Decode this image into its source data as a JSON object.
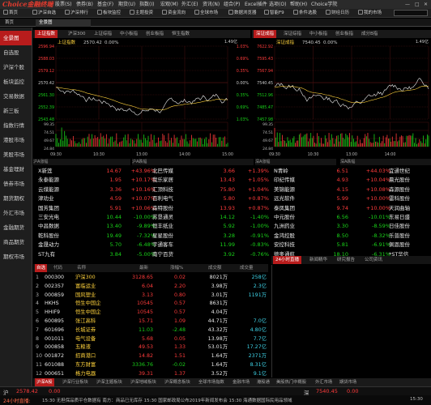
{
  "app": {
    "logo_text": "Choice金融终端",
    "menu": [
      "股票(S)",
      "债券(B)",
      "基金(F)",
      "期货(U)",
      "指数(I)",
      "宏观(M)",
      "外汇(E)",
      "资讯(N)",
      "组合(P)",
      "Excel插件",
      "选项(O)",
      "帮助(H)",
      "Choice学院"
    ],
    "toolbar": [
      "首页",
      "沪深自选",
      "沪深排行",
      "板块监控",
      "主题投资",
      "资金流向",
      "全球市场",
      "数据浏览器",
      "智能F9",
      "条件选股",
      "财经日历",
      "我的市场"
    ],
    "doc_tabs": [
      "首页",
      "全景图"
    ]
  },
  "sidebar": {
    "items": [
      "全景图",
      "自选股",
      "沪深个股",
      "板块监控",
      "交易数据",
      "新三板",
      "指数行情",
      "港股市场",
      "美股市场",
      "基金理财",
      "债券市场",
      "期货期权",
      "外汇市场",
      "金融期货",
      "商品期货",
      "期权市场"
    ],
    "more": "更多"
  },
  "left_chart": {
    "tabs": [
      "上证指数",
      "沪深300",
      "上证综指",
      "中小板指",
      "创业板指",
      "恒生指数"
    ],
    "header": "上证指数",
    "header_value": "2570.42",
    "header_pct": "0.00%",
    "y_labels": [
      "2596.94",
      "2588.03",
      "2579.12",
      "2570.42",
      "2561.30",
      "2552.39",
      "2543.48"
    ],
    "pct_labels": [
      "1.03%",
      "0.69%",
      "0.35%",
      "0.00%",
      "0.35%",
      "0.69%",
      "1.03%"
    ],
    "vol_label": "1.49亿",
    "vol_labels": [
      "99.35",
      "74.51",
      "49.67",
      "24.84"
    ],
    "times": [
      "09:30",
      "10:30",
      "13:00",
      "14:00",
      "15:00"
    ]
  },
  "right_chart": {
    "tabs": [
      "深证成指",
      "深证综指",
      "中小板指",
      "创业板指",
      "成分B指"
    ],
    "header": "深证成指",
    "header_value": "7540.45",
    "header_pct": "0.00%",
    "y_labels": [
      "7622.92",
      "7595.43",
      "7567.94",
      "7540.45",
      "7512.96",
      "7485.47",
      "7457.98"
    ],
    "vol_label": "1.49亿",
    "vol_labels": [
      "99.35",
      "74.51",
      "49.67",
      "24.84"
    ],
    "times": [
      "09:30",
      "10:30",
      "13:00",
      "14:00"
    ]
  },
  "rankings": {
    "headers": [
      "沪A涨幅",
      "沪A跌幅",
      "深A涨幅",
      "深A跌幅"
    ],
    "col1": [
      {
        "name": "X新莲",
        "price": "14.67",
        "pct": "+43.96%"
      },
      {
        "name": "永泰能源",
        "price": "1.95",
        "pct": "+10.17%"
      },
      {
        "name": "云煤能源",
        "price": "3.36",
        "pct": "+10.16%"
      },
      {
        "name": "津劝业",
        "price": "4.59",
        "pct": "+10.07%"
      },
      {
        "name": "国芳集团",
        "price": "5.91",
        "pct": "+10.06%"
      },
      {
        "name": "三安光电",
        "price": "10.44",
        "pct": "-10.00%"
      },
      {
        "name": "中昌数据",
        "price": "13.40",
        "pct": "-9.89%"
      },
      {
        "name": "乾科股份",
        "price": "19.49",
        "pct": "-7.32%"
      },
      {
        "name": "金晟动力",
        "price": "5.70",
        "pct": "-6.48%"
      },
      {
        "name": "ST九有",
        "price": "3.84",
        "pct": "-5.00%"
      }
    ],
    "col2": [
      {
        "name": "北巴传媒",
        "price": "3.66",
        "pct": "+1.39%"
      },
      {
        "name": "我乐家居",
        "price": "13.43",
        "pct": "+1.05%"
      },
      {
        "name": "汇顶科技",
        "price": "75.80",
        "pct": "+1.04%"
      },
      {
        "name": "百利电气",
        "price": "5.80",
        "pct": "+0.87%"
      },
      {
        "name": "森特股份",
        "price": "13.93",
        "pct": "+0.87%"
      },
      {
        "name": "苏垦通灵",
        "price": "14.12",
        "pct": "-1.40%"
      },
      {
        "name": "恒丰纸业",
        "price": "5.92",
        "pct": "-1.00%"
      },
      {
        "name": "星星股份",
        "price": "3.28",
        "pct": "-0.91%"
      },
      {
        "name": "宇通客车",
        "price": "11.99",
        "pct": "-0.83%"
      },
      {
        "name": "南宁百货",
        "price": "3.92",
        "pct": "-0.76%"
      }
    ],
    "col3": [
      {
        "name": "N青岭",
        "price": "6.51",
        "pct": "+44.03%"
      },
      {
        "name": "印纪传媒",
        "price": "4.93",
        "pct": "+10.04%"
      },
      {
        "name": "美锦能源",
        "price": "4.15",
        "pct": "+10.08%"
      },
      {
        "name": "远光软件",
        "price": "5.99",
        "pct": "+10.00%"
      },
      {
        "name": "泰凤集团",
        "price": "9.74",
        "pct": "+10.00%"
      },
      {
        "name": "中元股份",
        "price": "6.56",
        "pct": "-10.01%"
      },
      {
        "name": "九洲药业",
        "price": "3.30",
        "pct": "-8.59%"
      },
      {
        "name": "金鸿控股",
        "price": "8.50",
        "pct": "-8.32%"
      },
      {
        "name": "安控科技",
        "price": "5.81",
        "pct": "-6.91%"
      },
      {
        "name": "德奥通航",
        "price": "18.10",
        "pct": "-6.31%"
      }
    ],
    "col4": [
      {
        "name": "宜通世纪",
        "price": "",
        "pct": ""
      },
      {
        "name": "晨光股份",
        "price": "",
        "pct": ""
      },
      {
        "name": "森源股份",
        "price": "",
        "pct": ""
      },
      {
        "name": "雷科股份",
        "price": "",
        "pct": ""
      },
      {
        "name": "天润曲轴",
        "price": "",
        "pct": ""
      },
      {
        "name": "东易日盛",
        "price": "",
        "pct": ""
      },
      {
        "name": "日佳股份",
        "price": "",
        "pct": ""
      },
      {
        "name": "乐普股份",
        "price": "",
        "pct": ""
      },
      {
        "name": "佩恩股份",
        "price": "",
        "pct": ""
      },
      {
        "name": "*ST华信",
        "price": "",
        "pct": ""
      }
    ]
  },
  "watchlist": {
    "title": "自选",
    "headers": [
      "代码",
      "名称",
      "最新",
      "涨幅%",
      "成交额",
      "成交量"
    ],
    "rows": [
      {
        "no": "1",
        "code": "000300",
        "name": "沪深300",
        "last": "3128.65",
        "chg": "0.02",
        "amt": "8021万",
        "vol": "258亿"
      },
      {
        "no": "2",
        "code": "002357",
        "name": "富临运业",
        "last": "6.04",
        "chg": "2.20",
        "amt": "3.98万",
        "vol": "2.3亿"
      },
      {
        "no": "3",
        "code": "000859",
        "name": "国风塑业",
        "last": "3.13",
        "chg": "0.80",
        "amt": "3.01万",
        "vol": "1191万"
      },
      {
        "no": "4",
        "code": "HKHS",
        "name": "恒生中国企",
        "last": "10545",
        "chg": "0.57",
        "amt": "8631万",
        "vol": ""
      },
      {
        "no": "5",
        "code": "HHIF9",
        "name": "恒生中国企",
        "last": "10545",
        "chg": "0.57",
        "amt": "4.04万",
        "vol": ""
      },
      {
        "no": "6",
        "code": "600895",
        "name": "张江高科",
        "last": "15.71",
        "chg": "1.09",
        "amt": "44.71万",
        "vol": "7.0亿"
      },
      {
        "no": "7",
        "code": "601696",
        "name": "长城证券",
        "last": "11.03",
        "chg": "-2.48",
        "amt": "43.32万",
        "vol": "4.80亿"
      },
      {
        "no": "8",
        "code": "001011",
        "name": "电气设备",
        "last": "5.68",
        "chg": "0.05",
        "amt": "13.98万",
        "vol": "7.7亿"
      },
      {
        "no": "9",
        "code": "000858",
        "name": "五粮液",
        "last": "49.53",
        "chg": "1.33",
        "amt": "53.01万",
        "vol": "17.27亿"
      },
      {
        "no": "10",
        "code": "001872",
        "name": "招商港口",
        "last": "14.82",
        "chg": "1.51",
        "amt": "1.64万",
        "vol": "2371万"
      },
      {
        "no": "11",
        "code": "601088",
        "name": "东方财富",
        "last": "3336.76",
        "chg": "-0.02",
        "amt": "1.64万",
        "vol": "8.31亿"
      },
      {
        "no": "12",
        "code": "000651",
        "name": "格力电器",
        "last": "39.31",
        "chg": "1.37",
        "amt": "3.52万",
        "vol": "9.1亿"
      }
    ]
  },
  "news": {
    "tabs": [
      "24小时直播",
      "新闻精华",
      "研究报告",
      "公司资讯"
    ],
    "items": [],
    "times": []
  },
  "bottom_tabs": [
    "沪深A股",
    "沪深行业板块",
    "沪深主题板块",
    "沪深地域板块",
    "沪深概念板块",
    "全球市场指数",
    "金融市场",
    "港股通",
    "美股热门中概股",
    "外汇市场",
    "期货市场"
  ],
  "index_bar": {
    "label1": "沪",
    "val1": "2578.42",
    "chg1": "0.00",
    "label2": "深",
    "val2": "7540.45",
    "chg2": "0.00"
  },
  "status": {
    "left": "24小时直播:",
    "ticker": "15:30 无担保品质平仓数据有   南方：商品已无库存   15:30 国家邮政局公布2019年新闻发布会   15:30 海通数据国际民用品领域",
    "right": "15:30"
  }
}
